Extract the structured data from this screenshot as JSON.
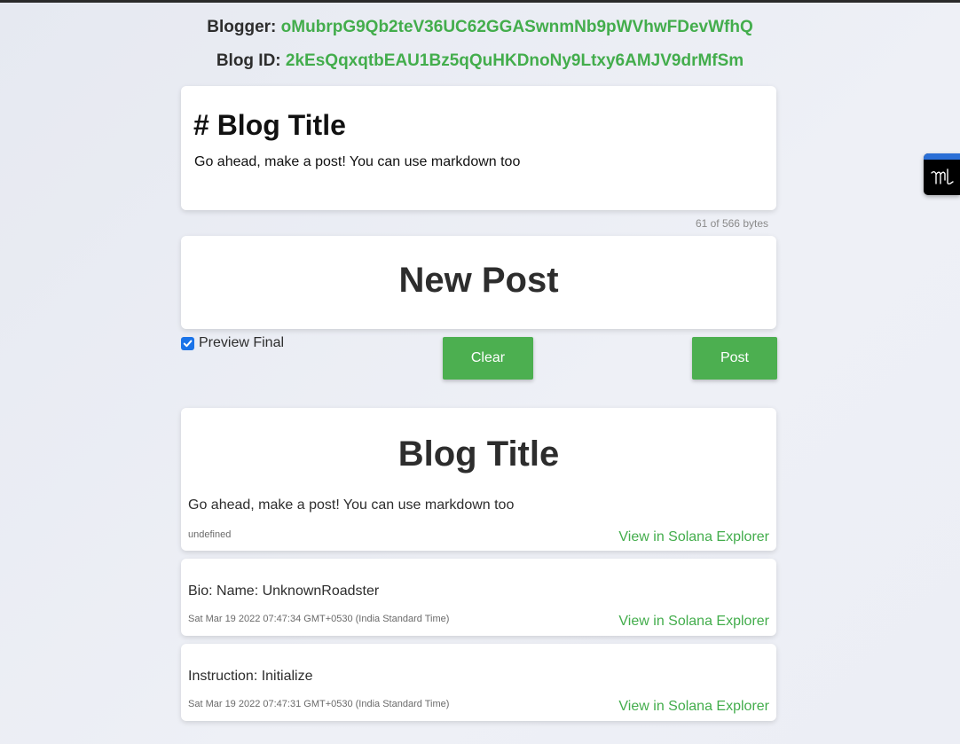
{
  "header": {
    "blogger_label": "Blogger:",
    "blogger_value": "oMubrpG9Qb2teV36UC62GGASwnmNb9pWVhwFDevWfhQ",
    "blog_id_label": "Blog ID:",
    "blog_id_value": "2kEsQqxqtbEAU1Bz5qQuHKDnoNy9Ltxy6AMJV9drMfSm"
  },
  "editor": {
    "title_line": "# Blog Title",
    "body_line": "Go ahead, make a post! You can use markdown too",
    "byte_counter": "61 of 566 bytes"
  },
  "new_post": {
    "heading": "New Post",
    "preview_label": "Preview Final",
    "preview_checked": true,
    "clear_label": "Clear",
    "post_label": "Post"
  },
  "preview": {
    "title": "Blog Title",
    "body": "Go ahead, make a post! You can use markdown too",
    "meta": "undefined",
    "link_label": "View in Solana Explorer"
  },
  "transactions": [
    {
      "text": "Bio: Name: UnknownRoadster",
      "timestamp": "Sat Mar 19 2022 07:47:34 GMT+0530 (India Standard Time)",
      "link_label": "View in Solana Explorer"
    },
    {
      "text": "Instruction: Initialize",
      "timestamp": "Sat Mar 19 2022 07:47:31 GMT+0530 (India Standard Time)",
      "link_label": "View in Solana Explorer"
    }
  ],
  "extension": {
    "icon": "ml-logo-icon"
  },
  "colors": {
    "accent_green": "#4caf50",
    "link_green": "#43ad4c",
    "checkbox_blue": "#1a73e8"
  }
}
